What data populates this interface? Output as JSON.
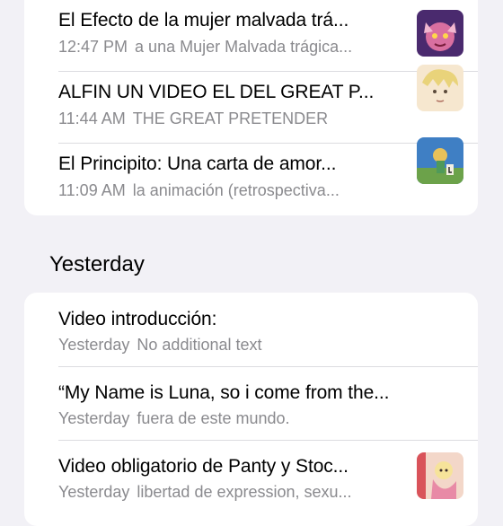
{
  "today": {
    "items": [
      {
        "title": "El Efecto de la mujer malvada trá...",
        "time": "12:47 PM",
        "preview": "a una Mujer Malvada trágica..."
      },
      {
        "title": "ALFIN UN VIDEO EL DEL GREAT P...",
        "time": "11:44 AM",
        "preview": "THE GREAT PRETENDER"
      },
      {
        "title": "El Principito: Una carta de amor...",
        "time": "11:09 AM",
        "preview": "la animación (retrospectiva..."
      }
    ]
  },
  "yesterday": {
    "header": "Yesterday",
    "items": [
      {
        "title": "Video introducción:",
        "time": "Yesterday",
        "preview": "No additional text"
      },
      {
        "title": "“My Name is Luna, so i come from the...",
        "time": "Yesterday",
        "preview": "fuera de este mundo."
      },
      {
        "title": "Video obligatorio de Panty y Stoc...",
        "time": "Yesterday",
        "preview": "libertad de expression, sexu..."
      }
    ]
  }
}
